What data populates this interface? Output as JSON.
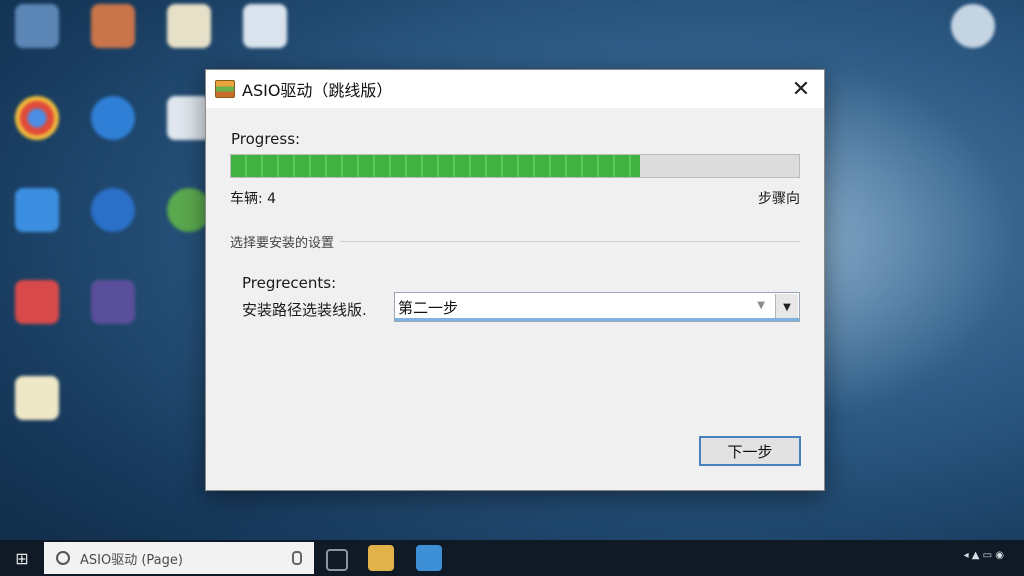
{
  "window": {
    "title": "ASIO驱动（跳线版）",
    "close_glyph": "✕",
    "progress_label": "Progress:",
    "progress_fraction": 0.72,
    "left_status": "车辆: 4",
    "right_status": "步骤向",
    "section_label": "选择要安装的设置",
    "options_label": "Pregrecents:",
    "path_label": "安装路径选装线版.",
    "select_value": "第二一步",
    "next_button": "下一步"
  },
  "taskbar": {
    "start_glyph": "⊞",
    "search_placeholder": "ASIO驱动 (Page)"
  },
  "colors": {
    "progress_green": "#3fb23f",
    "focus_blue": "#4a7fbf",
    "accent": "#7fb1e3"
  }
}
